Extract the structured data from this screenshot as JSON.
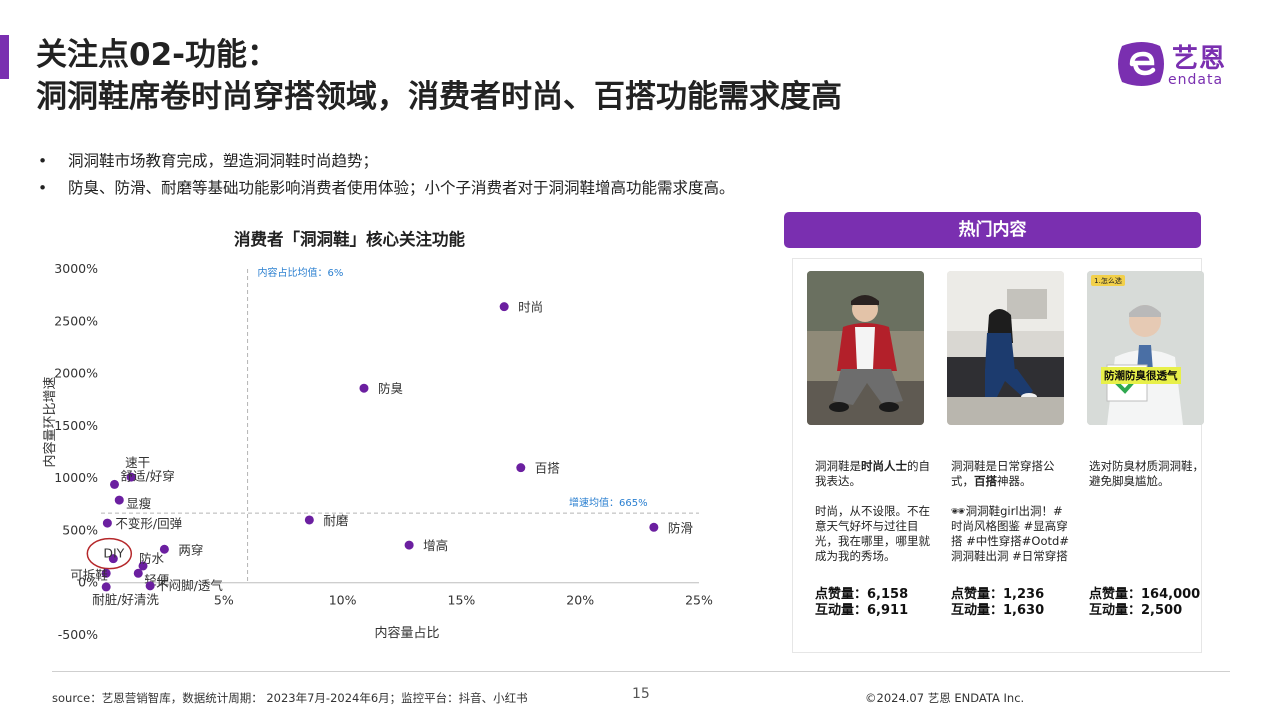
{
  "header": {
    "title_line1": "关注点02-功能：",
    "title_line2": "洞洞鞋席卷时尚穿搭领域，消费者时尚、百搭功能需求度高"
  },
  "logo": {
    "cn": "艺恩",
    "en": "endata"
  },
  "bullets": [
    "洞洞鞋市场教育完成，塑造洞洞鞋时尚趋势；",
    "防臭、防滑、耐磨等基础功能影响消费者使用体验；小个子消费者对于洞洞鞋增高功能需求度高。"
  ],
  "chart_data": {
    "type": "scatter",
    "title": "消费者「洞洞鞋」核心关注功能",
    "xlabel": "内容量占比",
    "ylabel": "内容量环比增速",
    "xlim": [
      0,
      25
    ],
    "ylim": [
      -500,
      3000
    ],
    "x_ticks": [
      "5%",
      "10%",
      "15%",
      "20%",
      "25%"
    ],
    "x_tick_values": [
      5,
      10,
      15,
      20,
      25
    ],
    "y_ticks": [
      "3000%",
      "2500%",
      "2000%",
      "1500%",
      "1000%",
      "500%",
      "0%",
      "-500%"
    ],
    "y_tick_values": [
      3000,
      2500,
      2000,
      1500,
      1000,
      500,
      0,
      -500
    ],
    "ref_x_label": "内容占比均值：6%",
    "ref_x_value": 6,
    "ref_y_label": "增速均值：665%",
    "ref_y_value": 665,
    "highlighted": "DIY",
    "point_color": "#6b1fa0",
    "points": [
      {
        "label": "时尚",
        "x": 16.8,
        "y": 2640
      },
      {
        "label": "防臭",
        "x": 10.9,
        "y": 1860
      },
      {
        "label": "百搭",
        "x": 17.5,
        "y": 1100
      },
      {
        "label": "防滑",
        "x": 23.1,
        "y": 530
      },
      {
        "label": "耐磨",
        "x": 8.6,
        "y": 600
      },
      {
        "label": "增高",
        "x": 12.8,
        "y": 360
      },
      {
        "label": "速干",
        "x": 1.1,
        "y": 1010
      },
      {
        "label": "舒适/好穿",
        "x": 0.4,
        "y": 940
      },
      {
        "label": "显瘦",
        "x": 0.6,
        "y": 790
      },
      {
        "label": "不变形/回弹",
        "x": 0.1,
        "y": 570
      },
      {
        "label": "DIY",
        "x": 0.35,
        "y": 230
      },
      {
        "label": "两穿",
        "x": 2.5,
        "y": 320
      },
      {
        "label": "防水",
        "x": 1.6,
        "y": 160
      },
      {
        "label": "可拆鞋",
        "x": 0.05,
        "y": 90
      },
      {
        "label": "轻便",
        "x": 1.4,
        "y": 90
      },
      {
        "label": "不闷脚/透气",
        "x": 1.9,
        "y": -30
      },
      {
        "label": "耐脏/好清洗",
        "x": 0.05,
        "y": -40
      }
    ]
  },
  "hot": {
    "header": "热门内容",
    "cards": [
      {
        "text_parts": [
          {
            "t": "洞洞鞋是",
            "b": false
          },
          {
            "t": "时尚人士",
            "b": true
          },
          {
            "t": "的自我表达。\n\n时尚，从不设限。不在意天气好坏与过往目光，我在哪里，哪里就成为我的秀场。",
            "b": false
          }
        ],
        "likes_label": "点赞量：",
        "likes": "6,158",
        "inter_label": "互动量：",
        "inter": "6,911"
      },
      {
        "text_parts": [
          {
            "t": "洞洞鞋是日常穿搭公式，",
            "b": false
          },
          {
            "t": "百搭",
            "b": true
          },
          {
            "t": "神器。\n\n🕶洞洞鞋girl出洞！#时尚风格图鉴 #显高穿搭 #中性穿搭#Ootd#洞洞鞋出洞 #日常穿搭",
            "b": false
          }
        ],
        "likes_label": "点赞量：",
        "likes": "1,236",
        "inter_label": "互动量：",
        "inter": "1,630"
      },
      {
        "text_parts": [
          {
            "t": "选对防臭材质洞洞鞋，避免脚臭尴尬。",
            "b": false
          }
        ],
        "likes_label": "点赞量：",
        "likes": "164,000",
        "inter_label": "互动量：",
        "inter": "2,500",
        "image_badge": "1.怎么选",
        "image_caption": "防潮防臭很透气"
      }
    ]
  },
  "footer": {
    "source": "source：艺恩营销智库，数据统计周期： 2023年7月-2024年6月；监控平台：抖音、小红书",
    "page": "15",
    "copyright": "©2024.07 艺恩 ENDATA Inc."
  }
}
